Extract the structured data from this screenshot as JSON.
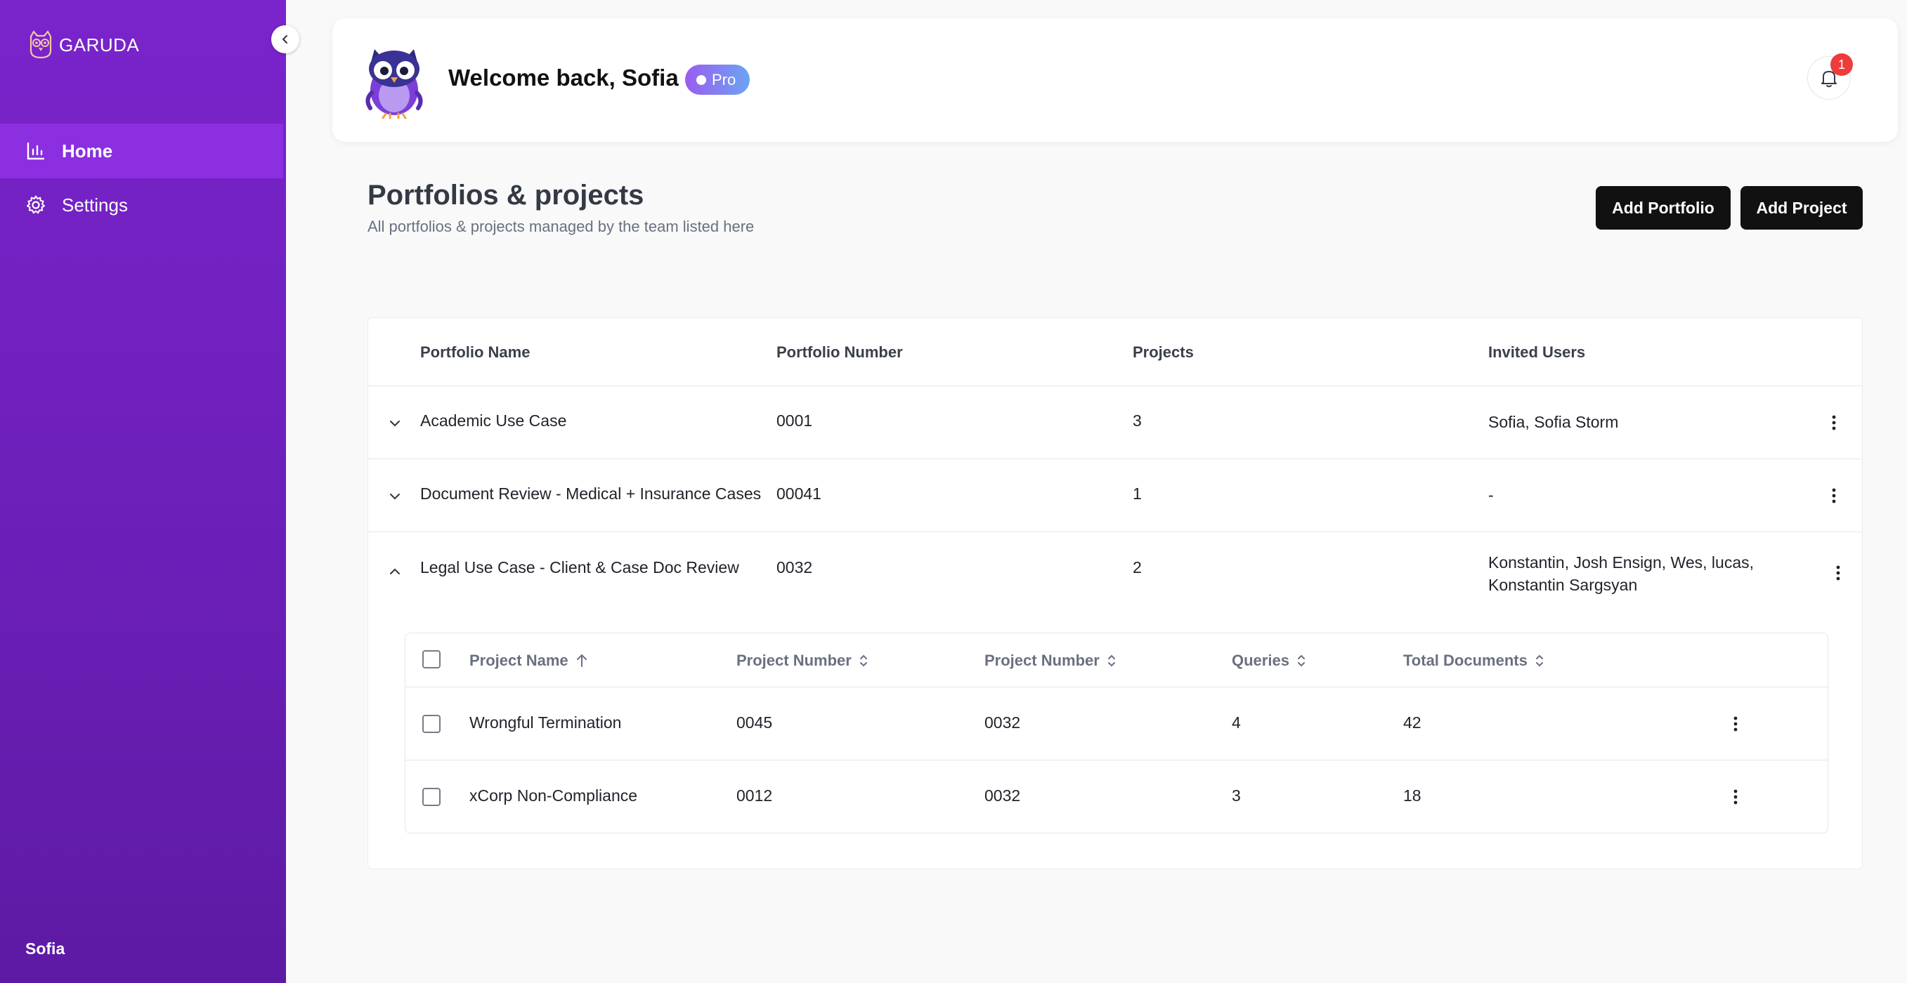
{
  "sidebar": {
    "brand": "GARUDA",
    "items": [
      {
        "label": "Home",
        "icon": "bar-chart-icon"
      },
      {
        "label": "Settings",
        "icon": "gear-icon"
      }
    ],
    "user": "Sofia",
    "colors": {
      "gradient_top": "#7a24cc",
      "gradient_bottom": "#5d1aa3",
      "active": "#8b2fe0"
    }
  },
  "header": {
    "welcome": "Welcome back, Sofia",
    "badge": "Pro",
    "notifications": "1"
  },
  "main": {
    "title": "Portfolios & projects",
    "subtitle": "All portfolios & projects managed by the team listed here",
    "buttons": {
      "add_portfolio": "Add Portfolio",
      "add_project": "Add Project"
    },
    "columns": [
      "Portfolio Name",
      "Portfolio Number",
      "Projects",
      "Invited Users"
    ],
    "portfolios": [
      {
        "name": "Academic Use Case",
        "number": "0001",
        "projects": "3",
        "users": "Sofia, Sofia Storm",
        "expanded": false
      },
      {
        "name": "Document Review - Medical + Insurance Cases",
        "number": "00041",
        "projects": "1",
        "users": "-",
        "expanded": false
      },
      {
        "name": "Legal Use Case - Client & Case Doc Review",
        "number": "0032",
        "projects": "2",
        "users_line1": "Konstantin, Josh Ensign, Wes, lucas,",
        "users_line2": "Konstantin Sargsyan",
        "expanded": true
      }
    ],
    "sub_table": {
      "columns": [
        "Project Name",
        "Project Number",
        "Project Number",
        "Queries",
        "Total Documents"
      ],
      "rows": [
        {
          "name": "Wrongful Termination",
          "project_number": "0045",
          "portfolio_number": "0032",
          "queries": "4",
          "documents": "42"
        },
        {
          "name": "xCorp Non-Compliance",
          "project_number": "0012",
          "portfolio_number": "0032",
          "queries": "3",
          "documents": "18"
        }
      ]
    }
  }
}
